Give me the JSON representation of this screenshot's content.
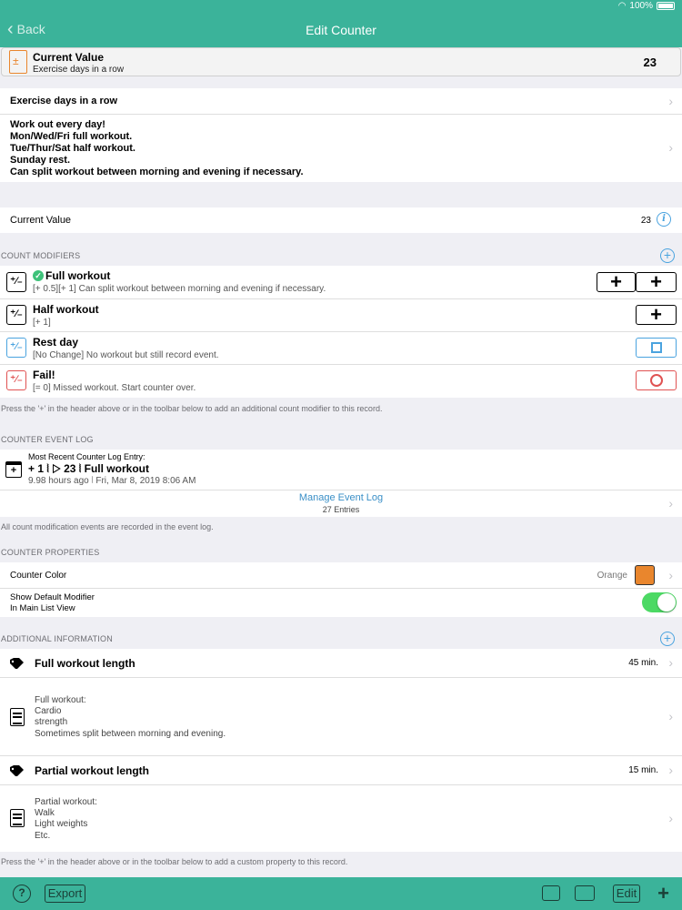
{
  "status": {
    "battery": "100%"
  },
  "nav": {
    "back_label": "Back",
    "title": "Edit Counter"
  },
  "banner": {
    "title": "Current Value",
    "subtitle": "Exercise days in a row",
    "value": "23"
  },
  "counter": {
    "name": "Exercise days in a row",
    "notes": [
      "Work out every day!",
      "Mon/Wed/Fri full workout.",
      "Tue/Thur/Sat half workout.",
      "Sunday rest.",
      "Can split workout between morning and evening if necessary."
    ],
    "current_value_label": "Current Value",
    "current_value": "23"
  },
  "count_modifiers": {
    "header": "COUNT MODIFIERS",
    "items": [
      {
        "name": "Full workout",
        "desc": "[+ 0.5][+ 1] Can split workout between morning and evening if necessary.",
        "default": true
      },
      {
        "name": "Half workout",
        "desc": "[+ 1]"
      },
      {
        "name": "Rest day",
        "desc": "[No Change] No workout but still record event."
      },
      {
        "name": "Fail!",
        "desc": "[= 0] Missed workout. Start counter over."
      }
    ],
    "footer": "Press the '+' in the header above or in the toolbar below to add an additional count modifier to this record."
  },
  "event_log": {
    "header": "COUNTER EVENT LOG",
    "recent_label": "Most Recent Counter Log Entry:",
    "entry_main": "+ 1 ⦚ ▷ 23 ⦚ Full workout",
    "entry_time": "9.98 hours ago ⦚ Fri, Mar 8, 2019 8:06 AM",
    "manage_label": "Manage Event Log",
    "entries_count": "27 Entries",
    "footer": "All count modification events are recorded in the event log."
  },
  "properties": {
    "header": "COUNTER PROPERTIES",
    "color_label": "Counter Color",
    "color_value": "Orange",
    "default_modifier_line1": "Show Default Modifier",
    "default_modifier_line2": "In Main List View",
    "accent_color": "#e9862d"
  },
  "additional_info": {
    "header": "ADDITIONAL INFORMATION",
    "items": [
      {
        "title": "Full workout length",
        "value": "45 min.",
        "note": [
          "Full workout:",
          "Cardio",
          "strength",
          "Sometimes split between morning and evening."
        ]
      },
      {
        "title": "Partial workout length",
        "value": "15 min.",
        "note": [
          "Partial workout:",
          "Walk",
          "Light weights",
          "Etc."
        ]
      }
    ],
    "footer": "Press the '+' in the header above or in the toolbar below to add a custom property to this record."
  },
  "toolbar": {
    "help": "?",
    "export_label": "Export",
    "edit_label": "Edit",
    "add": "+"
  },
  "icons": {
    "back": "chevron-left-icon",
    "info": "info-circle-icon",
    "add": "plus-circle-icon",
    "tag": "tag-icon",
    "note": "notepad-icon",
    "calendar": "calendar-plus-icon"
  }
}
